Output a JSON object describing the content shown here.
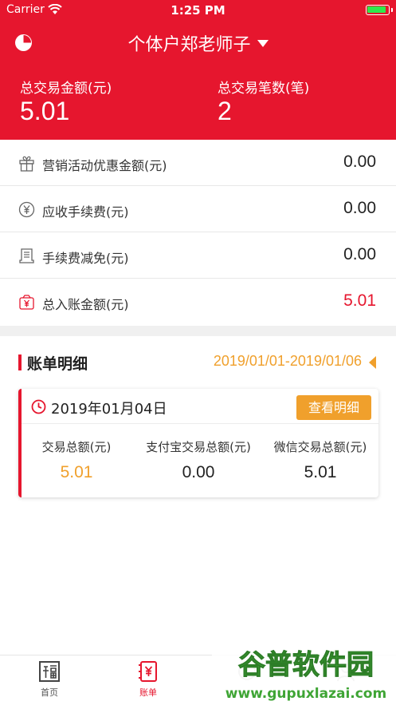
{
  "status_bar": {
    "carrier": "Carrier",
    "time": "1:25 PM"
  },
  "header": {
    "shop_name": "个体户郑老师子",
    "total_amount_label": "总交易金额(元)",
    "total_amount": "5.01",
    "total_count_label": "总交易笔数(笔)",
    "total_count": "2"
  },
  "fees": [
    {
      "icon": "gift-icon",
      "label": "营销活动优惠金额(元)",
      "value": "0.00"
    },
    {
      "icon": "yen-coin-icon",
      "label": "应收手续费(元)",
      "value": "0.00"
    },
    {
      "icon": "receipt-icon",
      "label": "手续费减免(元)",
      "value": "0.00"
    },
    {
      "icon": "money-bag-icon",
      "label": "总入账金额(元)",
      "value": "5.01"
    }
  ],
  "bill_detail": {
    "title": "账单明细",
    "date_range": "2019/01/01-2019/01/06",
    "card": {
      "date": "2019年01月04日",
      "view_button": "查看明细",
      "stats": [
        {
          "label": "交易总额(元)",
          "value": "5.01"
        },
        {
          "label": "支付宝交易总额(元)",
          "value": "0.00"
        },
        {
          "label": "微信交易总额(元)",
          "value": "5.01"
        }
      ]
    }
  },
  "tabbar": {
    "items": [
      {
        "label": "首页",
        "icon": "fu-home-icon",
        "active": false
      },
      {
        "label": "账单",
        "icon": "bill-icon",
        "active": true
      },
      {
        "label": "",
        "icon": "tab3-icon",
        "active": false
      },
      {
        "label": "",
        "icon": "tab4-icon",
        "active": false
      }
    ]
  },
  "watermark": {
    "text": "谷普软件园",
    "url": "www.gupuxlazai.com"
  },
  "colors": {
    "primary_red": "#e6162e",
    "accent_orange": "#f0a02c",
    "battery_green": "#2ee94c"
  }
}
